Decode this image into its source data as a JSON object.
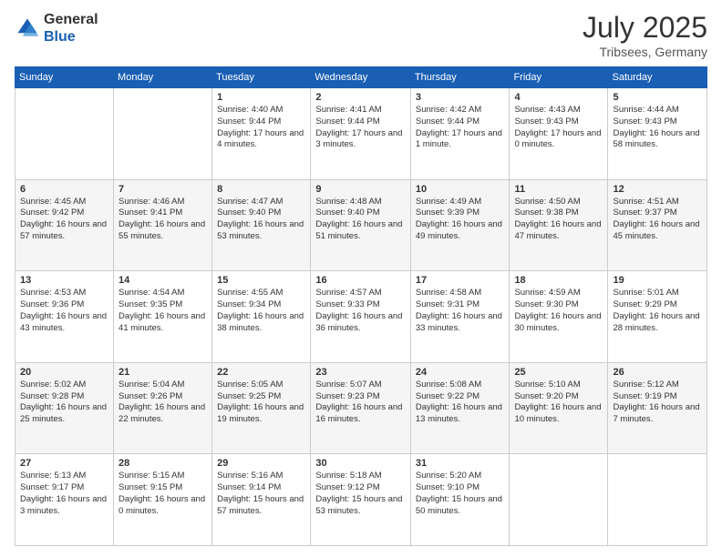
{
  "logo": {
    "general": "General",
    "blue": "Blue"
  },
  "title": "July 2025",
  "location": "Tribsees, Germany",
  "days_header": [
    "Sunday",
    "Monday",
    "Tuesday",
    "Wednesday",
    "Thursday",
    "Friday",
    "Saturday"
  ],
  "weeks": [
    [
      {
        "day": "",
        "sunrise": "",
        "sunset": "",
        "daylight": ""
      },
      {
        "day": "",
        "sunrise": "",
        "sunset": "",
        "daylight": ""
      },
      {
        "day": "1",
        "sunrise": "Sunrise: 4:40 AM",
        "sunset": "Sunset: 9:44 PM",
        "daylight": "Daylight: 17 hours and 4 minutes."
      },
      {
        "day": "2",
        "sunrise": "Sunrise: 4:41 AM",
        "sunset": "Sunset: 9:44 PM",
        "daylight": "Daylight: 17 hours and 3 minutes."
      },
      {
        "day": "3",
        "sunrise": "Sunrise: 4:42 AM",
        "sunset": "Sunset: 9:44 PM",
        "daylight": "Daylight: 17 hours and 1 minute."
      },
      {
        "day": "4",
        "sunrise": "Sunrise: 4:43 AM",
        "sunset": "Sunset: 9:43 PM",
        "daylight": "Daylight: 17 hours and 0 minutes."
      },
      {
        "day": "5",
        "sunrise": "Sunrise: 4:44 AM",
        "sunset": "Sunset: 9:43 PM",
        "daylight": "Daylight: 16 hours and 58 minutes."
      }
    ],
    [
      {
        "day": "6",
        "sunrise": "Sunrise: 4:45 AM",
        "sunset": "Sunset: 9:42 PM",
        "daylight": "Daylight: 16 hours and 57 minutes."
      },
      {
        "day": "7",
        "sunrise": "Sunrise: 4:46 AM",
        "sunset": "Sunset: 9:41 PM",
        "daylight": "Daylight: 16 hours and 55 minutes."
      },
      {
        "day": "8",
        "sunrise": "Sunrise: 4:47 AM",
        "sunset": "Sunset: 9:40 PM",
        "daylight": "Daylight: 16 hours and 53 minutes."
      },
      {
        "day": "9",
        "sunrise": "Sunrise: 4:48 AM",
        "sunset": "Sunset: 9:40 PM",
        "daylight": "Daylight: 16 hours and 51 minutes."
      },
      {
        "day": "10",
        "sunrise": "Sunrise: 4:49 AM",
        "sunset": "Sunset: 9:39 PM",
        "daylight": "Daylight: 16 hours and 49 minutes."
      },
      {
        "day": "11",
        "sunrise": "Sunrise: 4:50 AM",
        "sunset": "Sunset: 9:38 PM",
        "daylight": "Daylight: 16 hours and 47 minutes."
      },
      {
        "day": "12",
        "sunrise": "Sunrise: 4:51 AM",
        "sunset": "Sunset: 9:37 PM",
        "daylight": "Daylight: 16 hours and 45 minutes."
      }
    ],
    [
      {
        "day": "13",
        "sunrise": "Sunrise: 4:53 AM",
        "sunset": "Sunset: 9:36 PM",
        "daylight": "Daylight: 16 hours and 43 minutes."
      },
      {
        "day": "14",
        "sunrise": "Sunrise: 4:54 AM",
        "sunset": "Sunset: 9:35 PM",
        "daylight": "Daylight: 16 hours and 41 minutes."
      },
      {
        "day": "15",
        "sunrise": "Sunrise: 4:55 AM",
        "sunset": "Sunset: 9:34 PM",
        "daylight": "Daylight: 16 hours and 38 minutes."
      },
      {
        "day": "16",
        "sunrise": "Sunrise: 4:57 AM",
        "sunset": "Sunset: 9:33 PM",
        "daylight": "Daylight: 16 hours and 36 minutes."
      },
      {
        "day": "17",
        "sunrise": "Sunrise: 4:58 AM",
        "sunset": "Sunset: 9:31 PM",
        "daylight": "Daylight: 16 hours and 33 minutes."
      },
      {
        "day": "18",
        "sunrise": "Sunrise: 4:59 AM",
        "sunset": "Sunset: 9:30 PM",
        "daylight": "Daylight: 16 hours and 30 minutes."
      },
      {
        "day": "19",
        "sunrise": "Sunrise: 5:01 AM",
        "sunset": "Sunset: 9:29 PM",
        "daylight": "Daylight: 16 hours and 28 minutes."
      }
    ],
    [
      {
        "day": "20",
        "sunrise": "Sunrise: 5:02 AM",
        "sunset": "Sunset: 9:28 PM",
        "daylight": "Daylight: 16 hours and 25 minutes."
      },
      {
        "day": "21",
        "sunrise": "Sunrise: 5:04 AM",
        "sunset": "Sunset: 9:26 PM",
        "daylight": "Daylight: 16 hours and 22 minutes."
      },
      {
        "day": "22",
        "sunrise": "Sunrise: 5:05 AM",
        "sunset": "Sunset: 9:25 PM",
        "daylight": "Daylight: 16 hours and 19 minutes."
      },
      {
        "day": "23",
        "sunrise": "Sunrise: 5:07 AM",
        "sunset": "Sunset: 9:23 PM",
        "daylight": "Daylight: 16 hours and 16 minutes."
      },
      {
        "day": "24",
        "sunrise": "Sunrise: 5:08 AM",
        "sunset": "Sunset: 9:22 PM",
        "daylight": "Daylight: 16 hours and 13 minutes."
      },
      {
        "day": "25",
        "sunrise": "Sunrise: 5:10 AM",
        "sunset": "Sunset: 9:20 PM",
        "daylight": "Daylight: 16 hours and 10 minutes."
      },
      {
        "day": "26",
        "sunrise": "Sunrise: 5:12 AM",
        "sunset": "Sunset: 9:19 PM",
        "daylight": "Daylight: 16 hours and 7 minutes."
      }
    ],
    [
      {
        "day": "27",
        "sunrise": "Sunrise: 5:13 AM",
        "sunset": "Sunset: 9:17 PM",
        "daylight": "Daylight: 16 hours and 3 minutes."
      },
      {
        "day": "28",
        "sunrise": "Sunrise: 5:15 AM",
        "sunset": "Sunset: 9:15 PM",
        "daylight": "Daylight: 16 hours and 0 minutes."
      },
      {
        "day": "29",
        "sunrise": "Sunrise: 5:16 AM",
        "sunset": "Sunset: 9:14 PM",
        "daylight": "Daylight: 15 hours and 57 minutes."
      },
      {
        "day": "30",
        "sunrise": "Sunrise: 5:18 AM",
        "sunset": "Sunset: 9:12 PM",
        "daylight": "Daylight: 15 hours and 53 minutes."
      },
      {
        "day": "31",
        "sunrise": "Sunrise: 5:20 AM",
        "sunset": "Sunset: 9:10 PM",
        "daylight": "Daylight: 15 hours and 50 minutes."
      },
      {
        "day": "",
        "sunrise": "",
        "sunset": "",
        "daylight": ""
      },
      {
        "day": "",
        "sunrise": "",
        "sunset": "",
        "daylight": ""
      }
    ]
  ]
}
